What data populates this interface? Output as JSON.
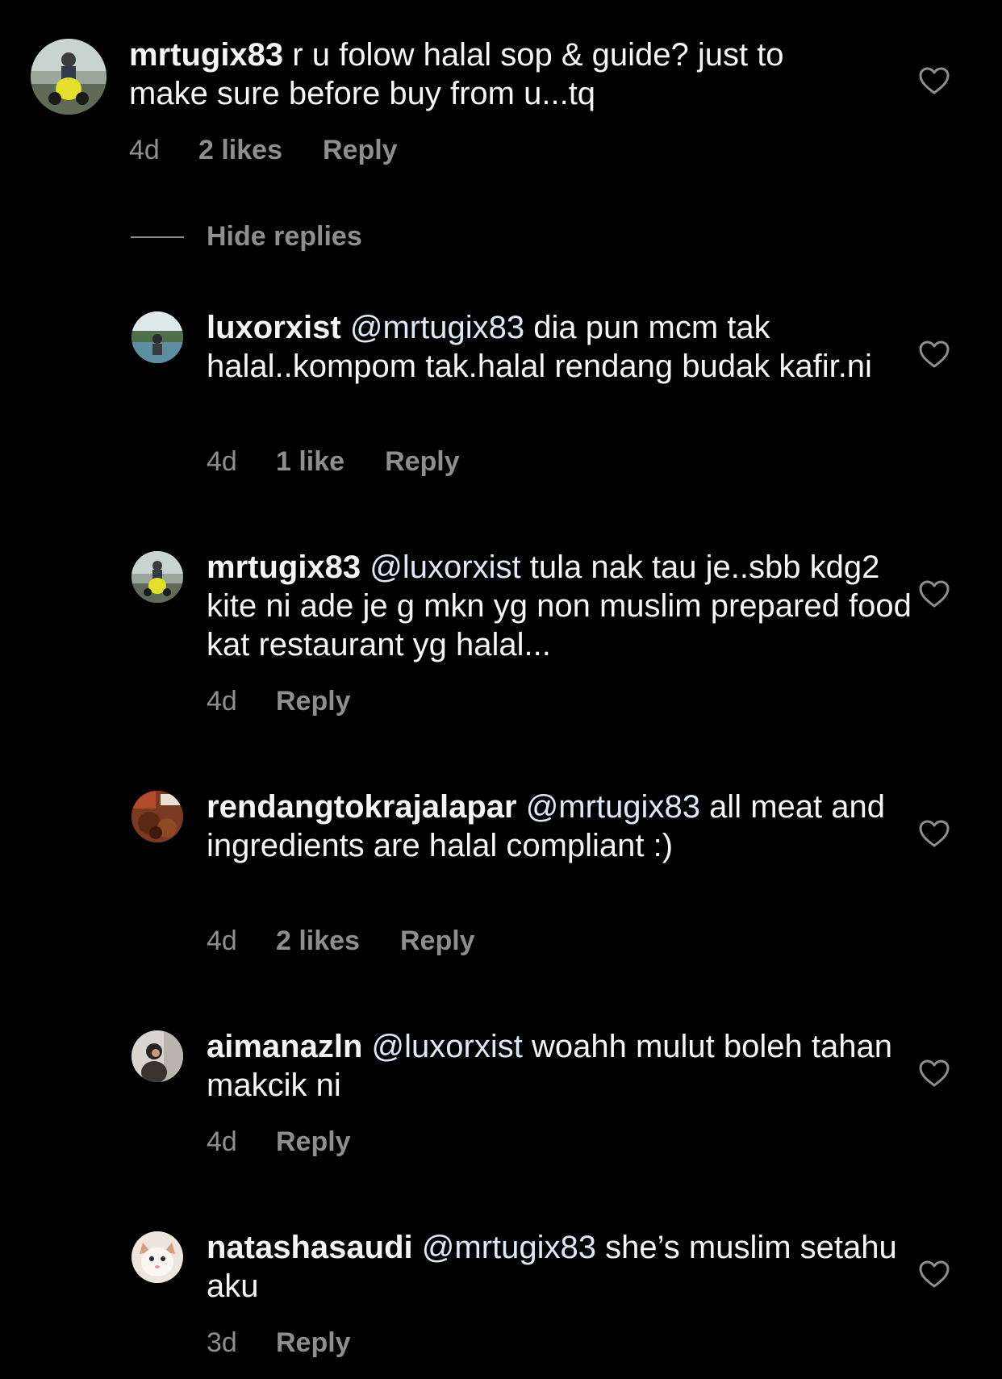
{
  "colors": {
    "background": "#000000",
    "text": "#f5f5f5",
    "secondary": "#8e8e8e"
  },
  "hide_replies_label": "Hide replies",
  "comments": [
    {
      "username": "mrtugix83",
      "mention": "",
      "text": "r u folow halal sop & guide? just to make sure before buy from u...tq",
      "time": "4d",
      "likes": "2 likes",
      "reply": "Reply",
      "avatar_icon": "motorcycle-rider-photo"
    },
    {
      "username": "luxorxist",
      "mention": "@mrtugix83",
      "text": "dia pun mcm tak halal..kompom tak.halal rendang budak kafir.ni",
      "time": "4d",
      "likes": "1 like",
      "reply": "Reply",
      "avatar_icon": "lake-photo"
    },
    {
      "username": "mrtugix83",
      "mention": "@luxorxist",
      "text": "tula nak tau je..sbb kdg2 kite ni ade je g mkn yg non muslim prepared food kat restaurant yg halal...",
      "time": "4d",
      "likes": "",
      "reply": "Reply",
      "avatar_icon": "motorcycle-rider-photo"
    },
    {
      "username": "rendangtokrajalapar",
      "mention": "@mrtugix83",
      "text": "all meat and ingredients are halal compliant :)",
      "time": "4d",
      "likes": "2 likes",
      "reply": "Reply",
      "avatar_icon": "rendang-food-photo"
    },
    {
      "username": "aimanazln",
      "mention": "@luxorxist",
      "text": "woahh mulut boleh tahan makcik ni",
      "time": "4d",
      "likes": "",
      "reply": "Reply",
      "avatar_icon": "person-photo"
    },
    {
      "username": "natashasaudi",
      "mention": "@mrtugix83",
      "text": "she’s muslim setahu aku",
      "time": "3d",
      "likes": "",
      "reply": "Reply",
      "avatar_icon": "cat-photo"
    }
  ]
}
